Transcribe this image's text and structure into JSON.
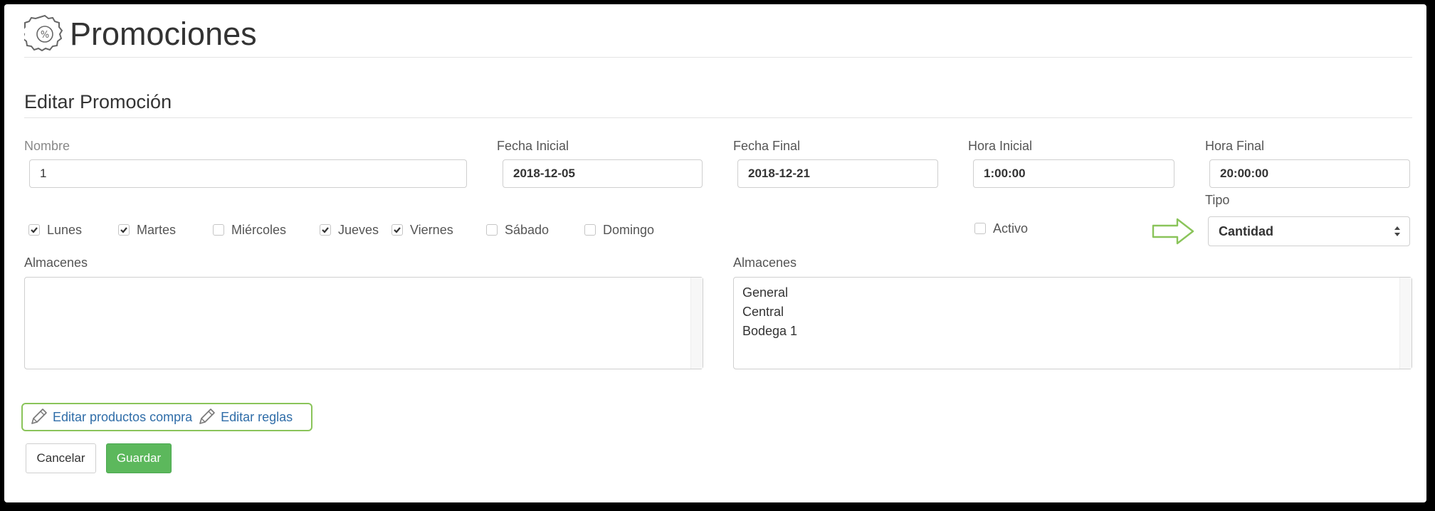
{
  "header": {
    "title": "Promociones",
    "icon": "percent-badge-icon"
  },
  "section": {
    "title": "Editar Promoción"
  },
  "fields": {
    "nombre": {
      "label": "Nombre",
      "value": "1"
    },
    "fecha_inicial": {
      "label": "Fecha Inicial",
      "value": "2018-12-05"
    },
    "fecha_final": {
      "label": "Fecha Final",
      "value": "2018-12-21"
    },
    "hora_inicial": {
      "label": "Hora Inicial",
      "value": "1:00:00"
    },
    "hora_final": {
      "label": "Hora Final",
      "value": "20:00:00"
    },
    "tipo": {
      "label": "Tipo",
      "value": "Cantidad"
    }
  },
  "days": [
    {
      "label": "Lunes",
      "checked": true
    },
    {
      "label": "Martes",
      "checked": true
    },
    {
      "label": "Miércoles",
      "checked": false
    },
    {
      "label": "Jueves",
      "checked": true
    },
    {
      "label": "Viernes",
      "checked": true
    },
    {
      "label": "Sábado",
      "checked": false
    },
    {
      "label": "Domingo",
      "checked": false
    }
  ],
  "activo": {
    "label": "Activo",
    "checked": false
  },
  "almacenes_left": {
    "label": "Almacenes",
    "items": []
  },
  "almacenes_right": {
    "label": "Almacenes",
    "items": [
      "General",
      "Central",
      "Bodega 1"
    ]
  },
  "links": {
    "edit_products": "Editar productos compra",
    "edit_rules": "Editar reglas"
  },
  "buttons": {
    "cancel": "Cancelar",
    "save": "Guardar"
  },
  "colors": {
    "accent_green": "#8ac45a",
    "save_green": "#5cb85c",
    "link_blue": "#2f6da8"
  }
}
